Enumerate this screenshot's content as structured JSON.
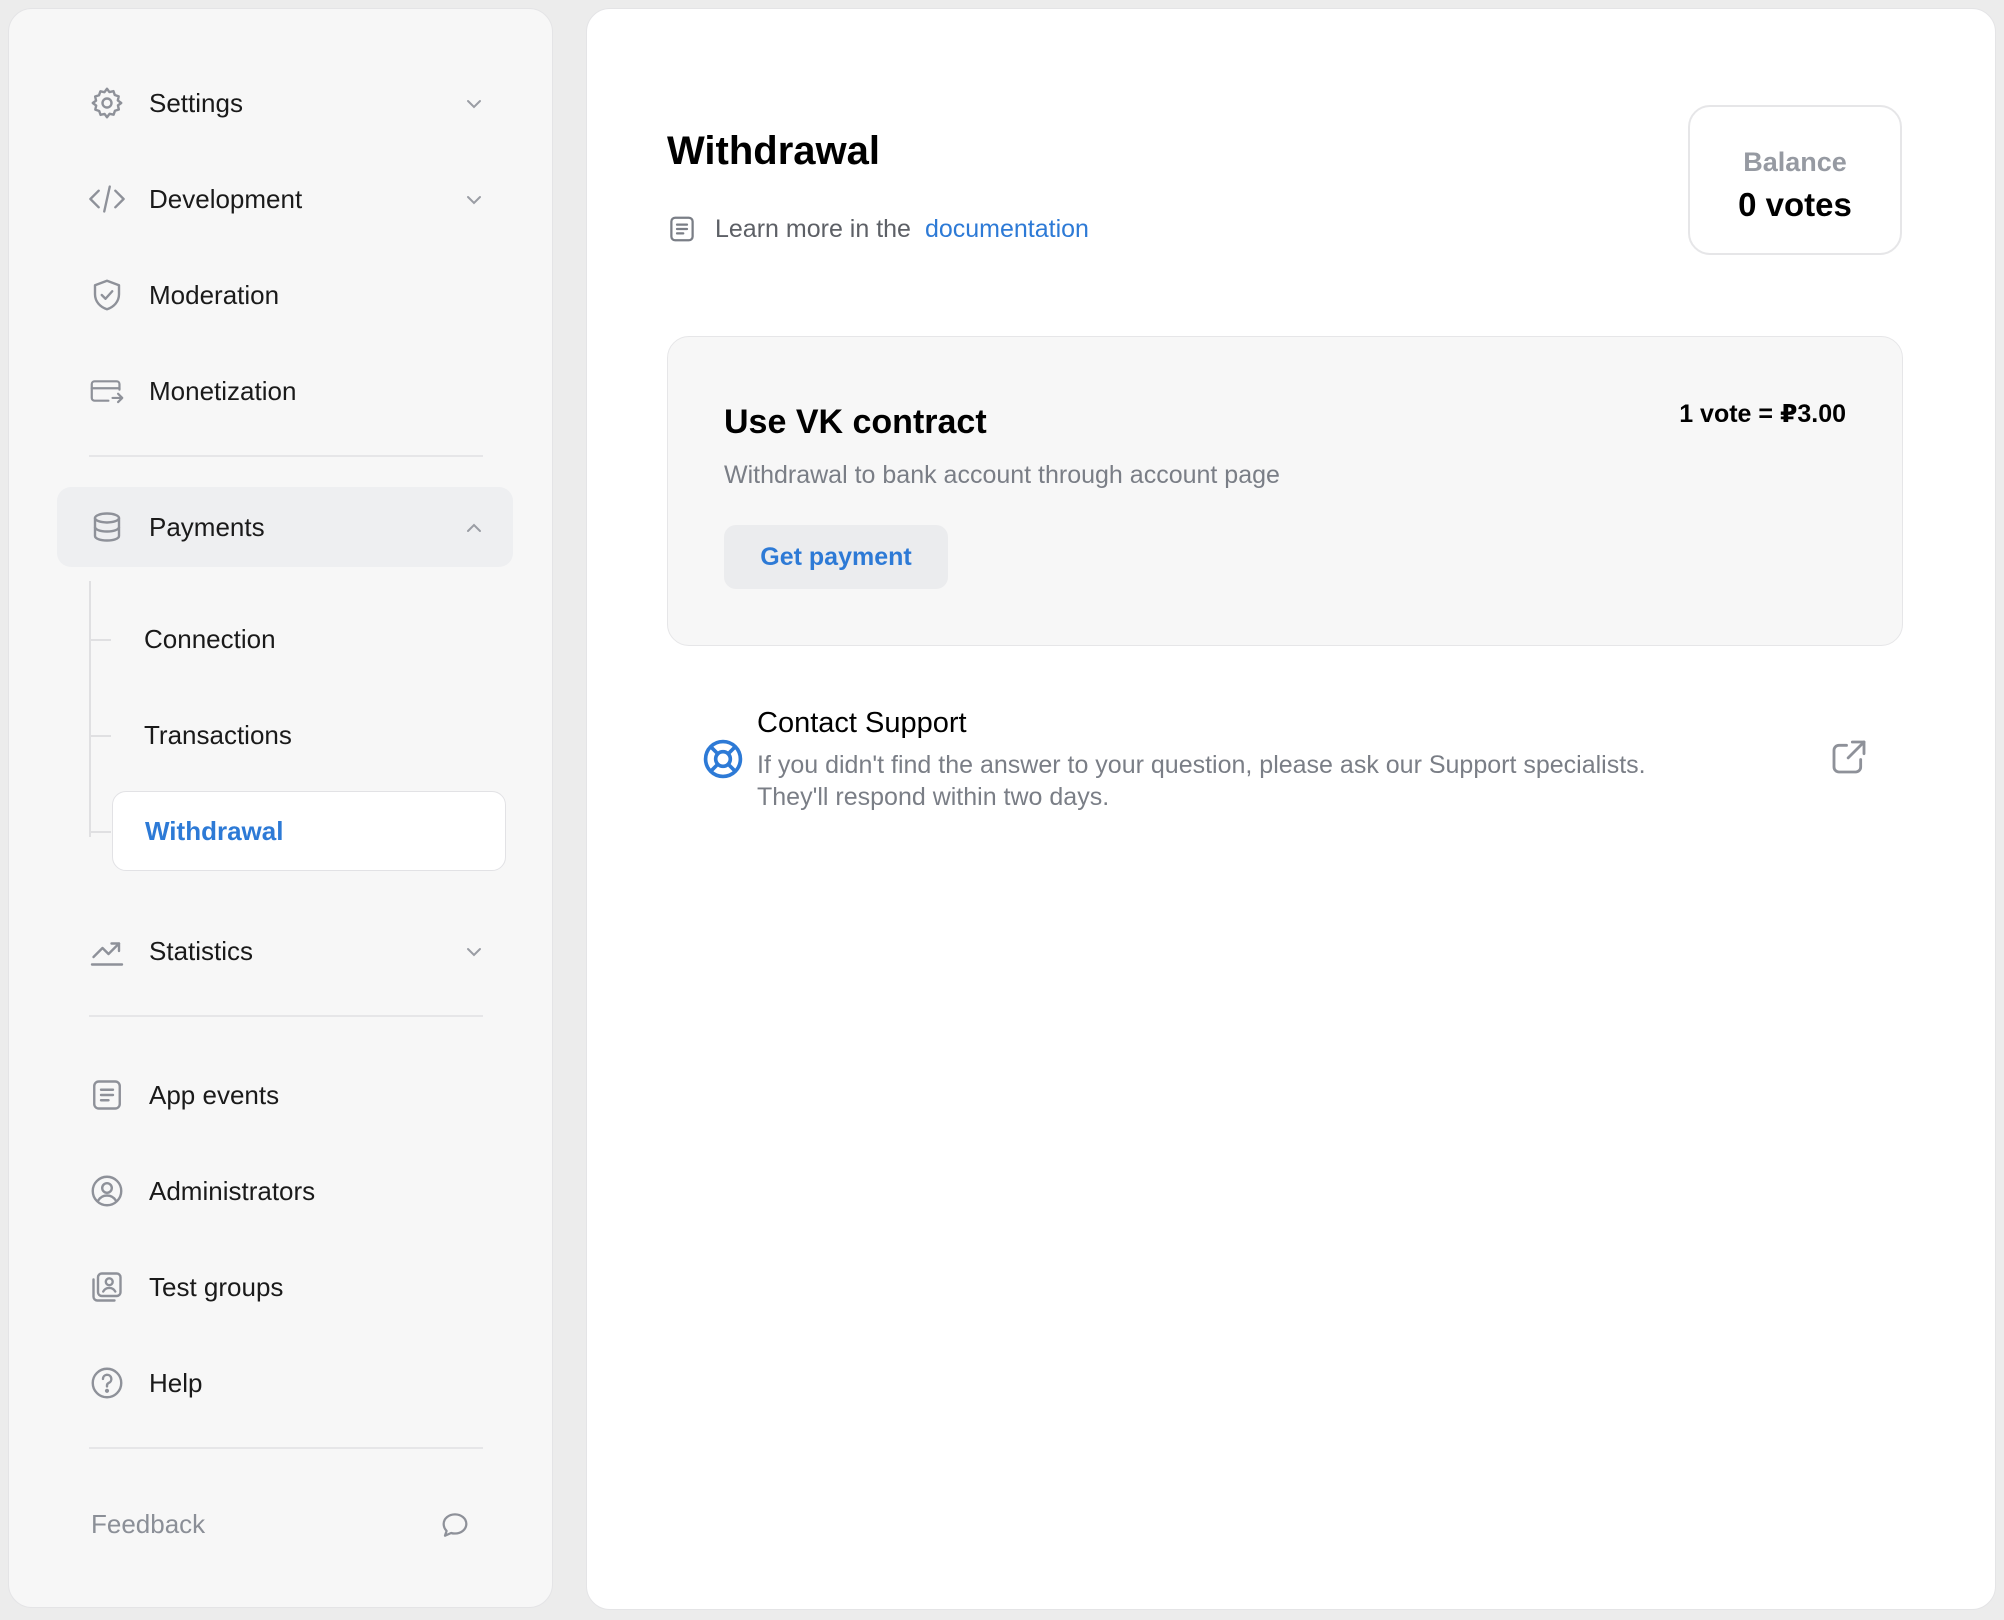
{
  "sidebar": {
    "items": [
      {
        "label": "Settings"
      },
      {
        "label": "Development"
      },
      {
        "label": "Moderation"
      },
      {
        "label": "Monetization"
      },
      {
        "label": "Payments"
      },
      {
        "label": "Statistics"
      },
      {
        "label": "App events"
      },
      {
        "label": "Administrators"
      },
      {
        "label": "Test groups"
      },
      {
        "label": "Help"
      }
    ],
    "payments_sub": [
      {
        "label": "Connection"
      },
      {
        "label": "Transactions"
      },
      {
        "label": "Withdrawal"
      }
    ],
    "feedback_label": "Feedback"
  },
  "main": {
    "title": "Withdrawal",
    "doc_text": "Learn more in the",
    "doc_link": "documentation",
    "balance": {
      "label": "Balance",
      "value": "0 votes"
    },
    "card": {
      "title": "Use VK contract",
      "rate": "1 vote = ₽3.00",
      "description": "Withdrawal to bank account through account page",
      "button": "Get payment"
    },
    "support": {
      "title": "Contact Support",
      "line1": "If you didn't find the answer to your question, please ask our Support specialists.",
      "line2": "They'll respond within two days."
    }
  },
  "colors": {
    "accent": "#2d7ad6",
    "muted": "#7a7e86",
    "icon": "#8e9199"
  },
  "icons": [
    "gear-icon",
    "code-icon",
    "shield-check-icon",
    "card-transfer-icon",
    "coins-stack-icon",
    "chart-up-icon",
    "list-doc-icon",
    "user-circle-icon",
    "user-card-icon",
    "help-circle-icon",
    "chat-bubble-icon",
    "lifebuoy-icon",
    "external-link-icon"
  ]
}
